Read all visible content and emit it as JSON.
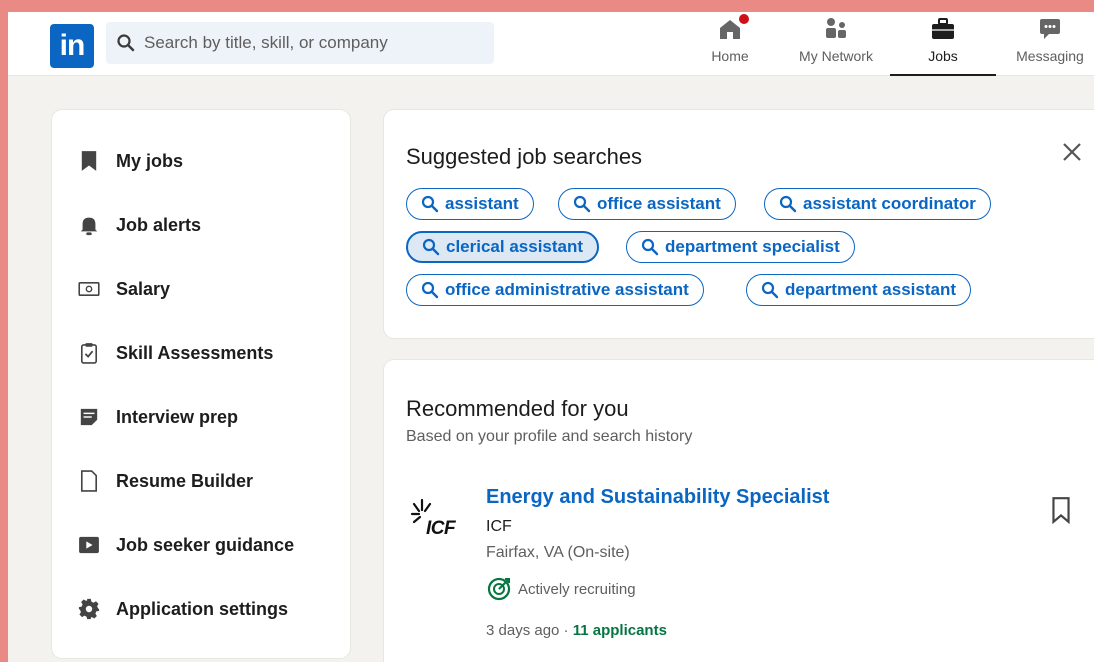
{
  "nav": {
    "logo_text": "in",
    "search_placeholder": "Search by title, skill, or company",
    "items": [
      {
        "label": "Home",
        "icon": "home-icon"
      },
      {
        "label": "My Network",
        "icon": "network-icon"
      },
      {
        "label": "Jobs",
        "icon": "briefcase-icon"
      },
      {
        "label": "Messaging",
        "icon": "messaging-icon"
      }
    ]
  },
  "sidebar": {
    "items": [
      {
        "label": "My jobs",
        "icon": "bookmark-icon"
      },
      {
        "label": "Job alerts",
        "icon": "bell-icon"
      },
      {
        "label": "Salary",
        "icon": "money-icon"
      },
      {
        "label": "Skill Assessments",
        "icon": "clipboard-check-icon"
      },
      {
        "label": "Interview prep",
        "icon": "notes-icon"
      },
      {
        "label": "Resume Builder",
        "icon": "document-icon"
      },
      {
        "label": "Job seeker guidance",
        "icon": "video-icon"
      },
      {
        "label": "Application settings",
        "icon": "gear-icon"
      }
    ]
  },
  "suggested": {
    "title": "Suggested job searches",
    "pills": [
      "assistant",
      "office assistant",
      "assistant coordinator",
      "clerical assistant",
      "department specialist",
      "office administrative assistant",
      "department assistant"
    ]
  },
  "recommended": {
    "title": "Recommended for you",
    "subtitle": "Based on your profile and search history",
    "job": {
      "title": "Energy and Sustainability Specialist",
      "company": "ICF",
      "location": "Fairfax, VA (On-site)",
      "status": "Actively recruiting",
      "posted": "3 days ago · ",
      "applicants": "11 applicants",
      "logo_text": "ICF"
    }
  },
  "colors": {
    "brand": "#0a66c2",
    "frame": "#e98b84",
    "success": "#057642",
    "badge": "#cc1016"
  }
}
